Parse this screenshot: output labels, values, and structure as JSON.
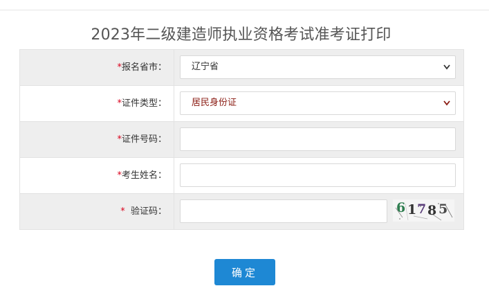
{
  "page_title": "2023年二级建造师执业资格考试准考证打印",
  "form": {
    "province": {
      "required": "*",
      "label": "报名省市：",
      "value": "辽宁省"
    },
    "id_type": {
      "required": "*",
      "label": "证件类型：",
      "value": "居民身份证"
    },
    "id_number": {
      "required": "*",
      "label": "证件号码：",
      "value": ""
    },
    "name": {
      "required": "*",
      "label": "考生姓名：",
      "value": ""
    },
    "captcha": {
      "required": "*",
      "label": "验证码：",
      "value": "",
      "digits": [
        "6",
        "1",
        "7",
        "8",
        "5"
      ]
    }
  },
  "submit_label": "确定",
  "colors": {
    "required_mark": "#d9001b",
    "button": "#1e88d4",
    "row_shade": "#eeeeee",
    "captcha_digits": [
      "#2e7d4f",
      "#333333",
      "#5a3d7a",
      "#333333",
      "#4a4a4a"
    ]
  },
  "icons": {
    "select_arrow": "chevron-down-icon"
  }
}
